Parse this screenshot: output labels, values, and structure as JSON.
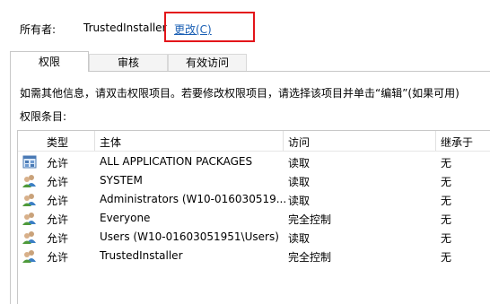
{
  "owner": {
    "label": "所有者:",
    "value": "TrustedInstaller",
    "change_link": "更改(C)"
  },
  "colors": {
    "highlight": "#e3151a",
    "link": "#1a5fb4"
  },
  "tabs": [
    {
      "label": "权限",
      "active": true
    },
    {
      "label": "审核",
      "active": false
    },
    {
      "label": "有效访问",
      "active": false
    }
  ],
  "info_text": "如需其他信息，请双击权限项目。若要修改权限项目，请选择该项目并单击“编辑”(如果可用)",
  "entries_label": "权限条目:",
  "table": {
    "headers": {
      "type": "类型",
      "principal": "主体",
      "access": "访问",
      "inherited": "继承于"
    },
    "rows": [
      {
        "icon": "app-packages-icon",
        "type": "允许",
        "principal": "ALL APPLICATION PACKAGES",
        "access": "读取",
        "inherited": "无"
      },
      {
        "icon": "users-icon",
        "type": "允许",
        "principal": "SYSTEM",
        "access": "读取",
        "inherited": "无"
      },
      {
        "icon": "users-icon",
        "type": "允许",
        "principal": "Administrators (W10-016030519...",
        "access": "读取",
        "inherited": "无"
      },
      {
        "icon": "users-icon",
        "type": "允许",
        "principal": "Everyone",
        "access": "完全控制",
        "inherited": "无"
      },
      {
        "icon": "users-icon",
        "type": "允许",
        "principal": "Users (W10-01603051951\\Users)",
        "access": "读取",
        "inherited": "无"
      },
      {
        "icon": "users-icon",
        "type": "允许",
        "principal": "TrustedInstaller",
        "access": "完全控制",
        "inherited": "无"
      }
    ]
  }
}
